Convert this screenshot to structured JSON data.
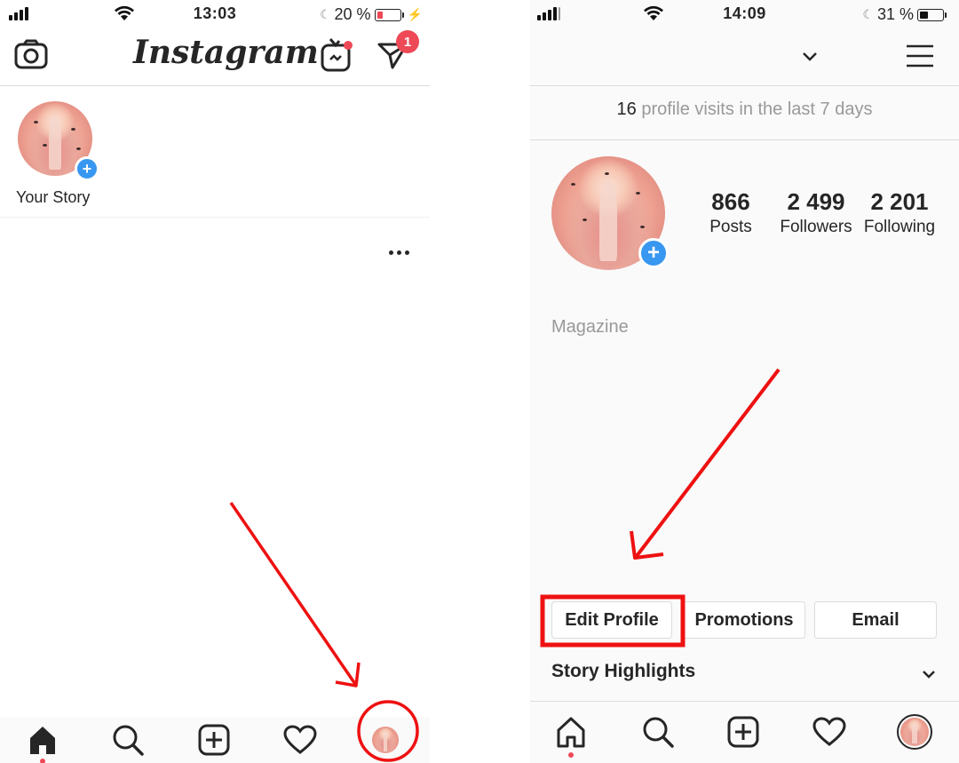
{
  "left": {
    "status": {
      "time": "13:03",
      "battery": "20 %"
    },
    "header": {
      "logo": "Instagram",
      "notification_count": "1"
    },
    "story": {
      "label": "Your Story"
    }
  },
  "right": {
    "status": {
      "time": "14:09",
      "battery": "31 %"
    },
    "visits": {
      "count": "16",
      "text": "profile visits in the last 7 days"
    },
    "stats": {
      "posts": {
        "value": "866",
        "label": "Posts"
      },
      "followers": {
        "value": "2 499",
        "label": "Followers"
      },
      "following": {
        "value": "2 201",
        "label": "Following"
      }
    },
    "bio": "Magazine",
    "buttons": {
      "edit_profile": "Edit Profile",
      "promotions": "Promotions",
      "email": "Email"
    },
    "highlights": "Story Highlights"
  },
  "colors": {
    "accent": "#3897f0",
    "notification": "#ed4956",
    "annotation": "#ee1111"
  }
}
